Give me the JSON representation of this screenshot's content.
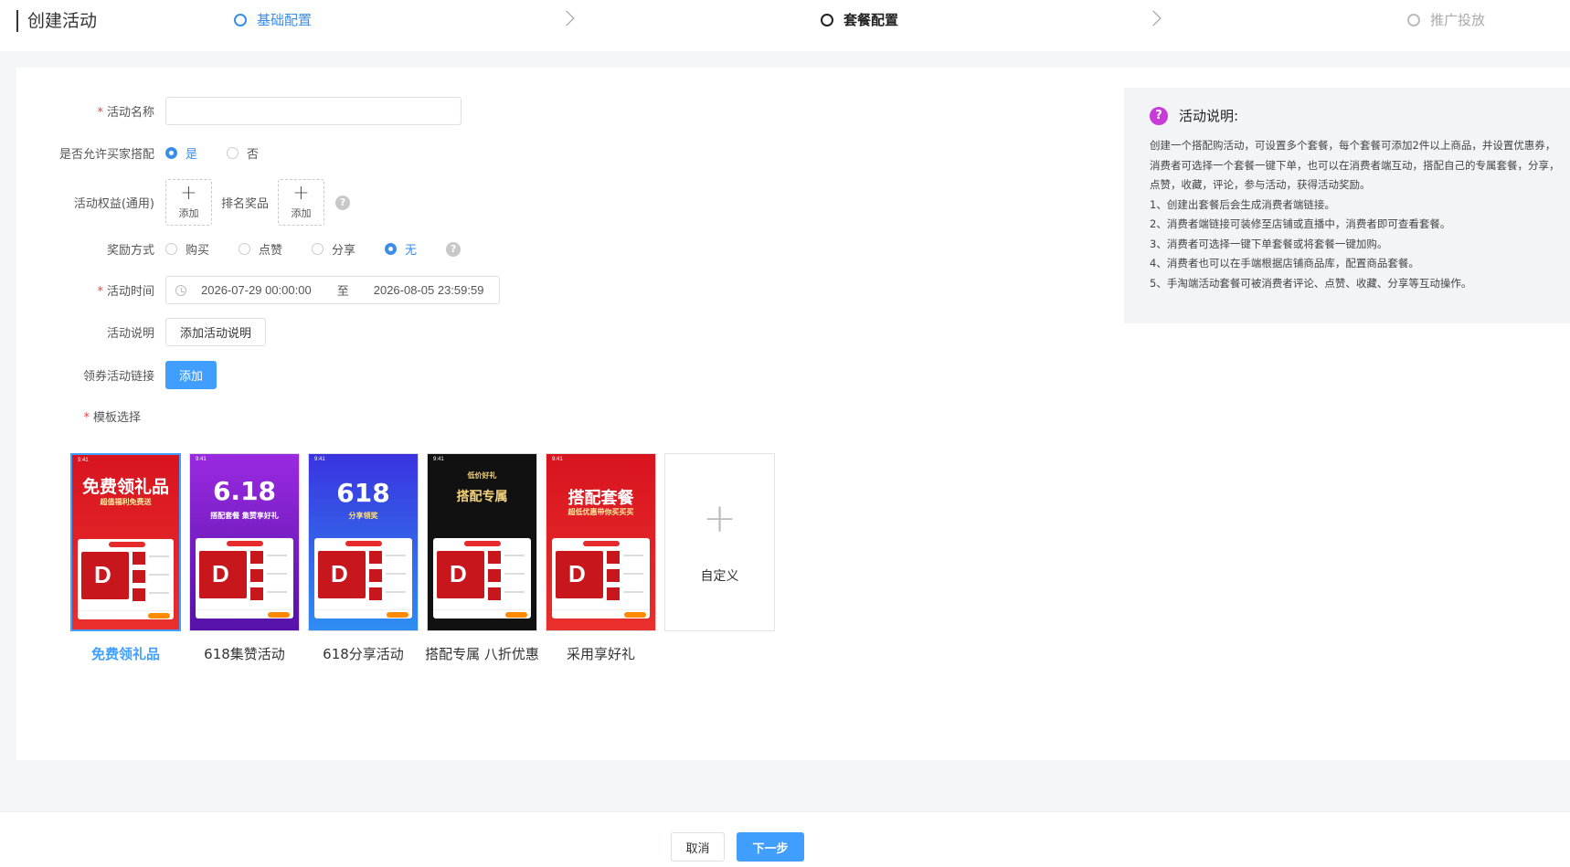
{
  "header": {
    "title": "创建活动",
    "steps": [
      {
        "label": "基础配置",
        "state": "active"
      },
      {
        "label": "套餐配置",
        "state": "current"
      },
      {
        "label": "推广投放",
        "state": "pending"
      }
    ]
  },
  "form": {
    "name": {
      "label": "活动名称",
      "required": true,
      "value": "",
      "placeholder": ""
    },
    "allow_combo": {
      "label": "是否允许买家搭配",
      "options": [
        "是",
        "否"
      ],
      "selected": "是"
    },
    "benefits": {
      "label": "活动权益(通用)",
      "add_label": "添加",
      "rank_label": "排名奖品",
      "rank_add_label": "添加"
    },
    "reward": {
      "label": "奖励方式",
      "options": [
        "购买",
        "点赞",
        "分享",
        "无"
      ],
      "selected": "无"
    },
    "time": {
      "label": "活动时间",
      "required": true,
      "start": "2026-07-29 00:00:00",
      "separator": "至",
      "end": "2026-08-05 23:59:59"
    },
    "description": {
      "label": "活动说明",
      "button": "添加活动说明"
    },
    "coupon": {
      "label": "领券活动链接",
      "button": "添加"
    },
    "template": {
      "label": "模板选择",
      "required": true
    }
  },
  "templates": [
    {
      "name": "免费领礼品",
      "selected": true,
      "banner": "免费领礼品",
      "subtitle": "超值福利免费送",
      "color_top": "#d8141f",
      "color_bottom": "#e8302c"
    },
    {
      "name": "618集赞活动",
      "selected": false,
      "banner": "6.18",
      "subtitle": "搭配套餐 集赞享好礼",
      "color_top": "#8a1fd6",
      "color_bottom": "#5a12b0"
    },
    {
      "name": "618分享活动",
      "selected": false,
      "banner": "618",
      "subtitle": "分享领奖",
      "color_top": "#3b3ee8",
      "color_bottom": "#2a8cf0"
    },
    {
      "name": "搭配专属 八折优惠",
      "selected": false,
      "banner": "搭配专属",
      "subtitle": "低价好礼",
      "color_top": "#111111",
      "color_bottom": "#1a1a1a"
    },
    {
      "name": "采用享好礼",
      "selected": false,
      "banner": "搭配套餐",
      "subtitle": "超低优惠带你买买买",
      "color_top": "#d8141f",
      "color_bottom": "#e8302c"
    }
  ],
  "custom_template": {
    "label": "自定义"
  },
  "info": {
    "title": "活动说明:",
    "paragraphs": [
      "创建一个搭配购活动，可设置多个套餐，每个套餐可添加2件以上商品，并设置优惠券，消费者可选择一个套餐一键下单，也可以在消费者端互动，搭配自己的专属套餐，分享，点赞，收藏，评论，参与活动，获得活动奖励。",
      "1、创建出套餐后会生成消费者端链接。",
      "2、消费者端链接可装修至店铺或直播中，消费者即可查看套餐。",
      "3、消费者可选择一键下单套餐或将套餐一键加购。",
      "4、消费者也可以在手端根据店铺商品库，配置商品套餐。",
      "5、手淘端活动套餐可被消费者评论、点赞、收藏、分享等互动操作。"
    ]
  },
  "footer": {
    "cancel": "取消",
    "next": "下一步"
  },
  "colors": {
    "primary": "#409eff",
    "accent_help": "#c83bd8",
    "required": "#e64545"
  }
}
